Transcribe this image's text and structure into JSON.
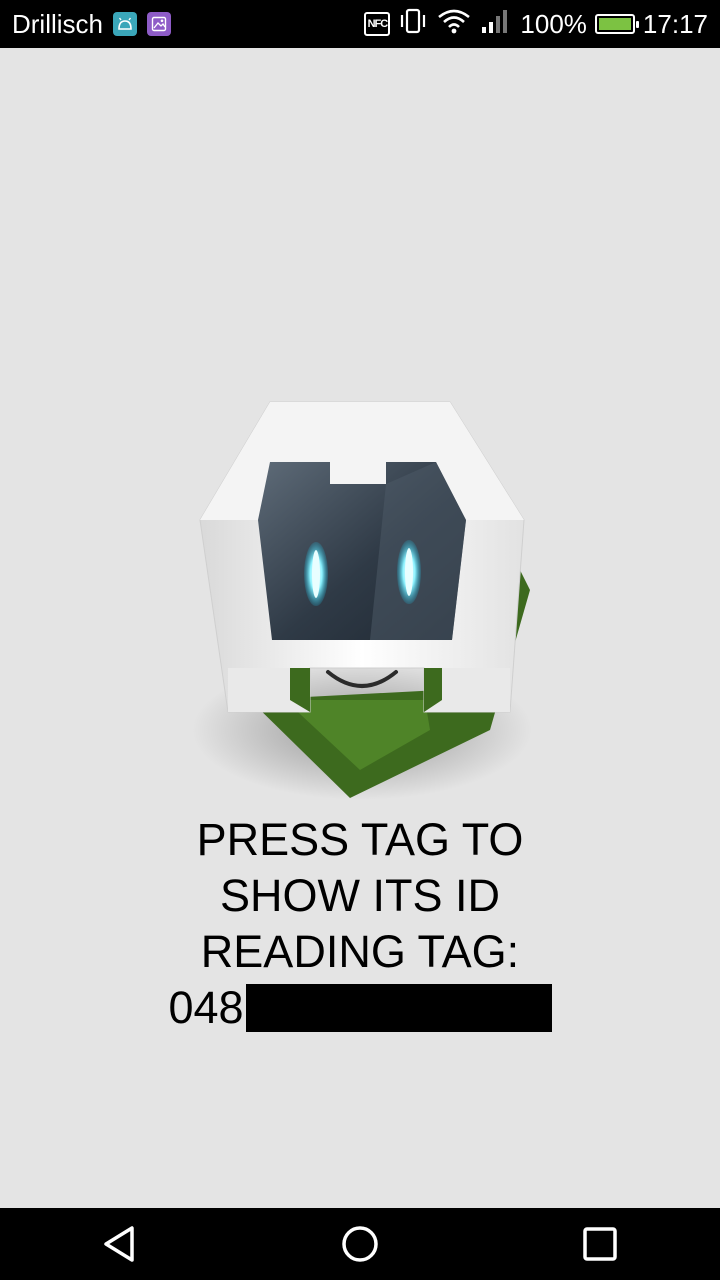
{
  "status_bar": {
    "carrier": "Drillisch",
    "nfc_label": "NFC",
    "battery_percent": "100%",
    "time": "17:17",
    "notification_icons": [
      "android-icon",
      "gallery-icon"
    ],
    "icons": [
      "nfc-icon",
      "vibrate-icon",
      "wifi-icon",
      "signal-icon",
      "battery-icon"
    ],
    "battery_color": "#7cc242"
  },
  "main": {
    "logo": "cordova-logo",
    "instruction_line1": "PRESS TAG TO",
    "instruction_line2": "SHOW ITS ID",
    "reading_label": "READING TAG:",
    "tag_id_prefix": "048"
  },
  "nav_bar": {
    "buttons": [
      "back-icon",
      "home-icon",
      "recents-icon"
    ]
  }
}
